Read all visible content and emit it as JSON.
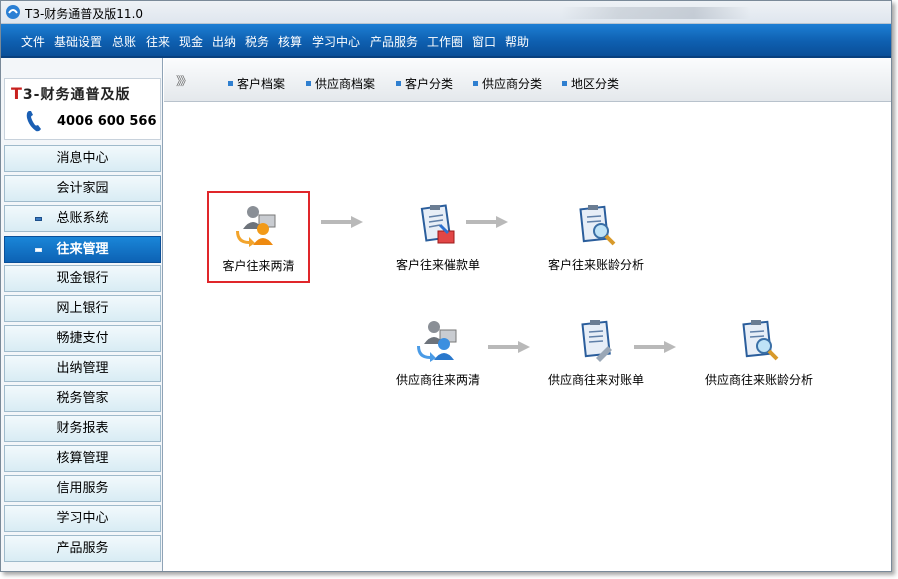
{
  "window": {
    "title": "T3-财务通普及版11.0"
  },
  "menu": [
    "文件",
    "基础设置",
    "总账",
    "往来",
    "现金",
    "出纳",
    "税务",
    "核算",
    "学习中心",
    "产品服务",
    "工作圈",
    "窗口",
    "帮助"
  ],
  "brand": {
    "logo_text_prefix": "T",
    "logo_text_rest": "3-财务通普及版",
    "phone": "4006 600 566"
  },
  "sidebar": {
    "items": [
      {
        "label": "消息中心",
        "active": false,
        "bullet": false
      },
      {
        "label": "会计家园",
        "active": false,
        "bullet": false
      },
      {
        "label": "总账系统",
        "active": false,
        "bullet": true
      },
      {
        "label": "往来管理",
        "active": true,
        "bullet": true
      },
      {
        "label": "现金银行",
        "active": false,
        "bullet": false
      },
      {
        "label": "网上银行",
        "active": false,
        "bullet": false
      },
      {
        "label": "畅捷支付",
        "active": false,
        "bullet": false
      },
      {
        "label": "出纳管理",
        "active": false,
        "bullet": false
      },
      {
        "label": "税务管家",
        "active": false,
        "bullet": false
      },
      {
        "label": "财务报表",
        "active": false,
        "bullet": false
      },
      {
        "label": "核算管理",
        "active": false,
        "bullet": false
      },
      {
        "label": "信用服务",
        "active": false,
        "bullet": false
      },
      {
        "label": "学习中心",
        "active": false,
        "bullet": false
      },
      {
        "label": "产品服务",
        "active": false,
        "bullet": false
      }
    ]
  },
  "toolbar": {
    "chevron": "》》",
    "items": [
      "客户档案",
      "供应商档案",
      "客户分类",
      "供应商分类",
      "地区分类"
    ]
  },
  "flow": {
    "customer": [
      {
        "label": "客户往来两清",
        "icon": "people-exchange-icon",
        "selected": true
      },
      {
        "label": "客户往来催款单",
        "icon": "document-notice-icon",
        "selected": false
      },
      {
        "label": "客户往来账龄分析",
        "icon": "clipboard-search-icon",
        "selected": false
      }
    ],
    "supplier": [
      {
        "label": "供应商往来两清",
        "icon": "people-exchange-icon",
        "selected": false
      },
      {
        "label": "供应商往来对账单",
        "icon": "clipboard-doc-icon",
        "selected": false
      },
      {
        "label": "供应商往来账龄分析",
        "icon": "clipboard-search-icon",
        "selected": false
      }
    ]
  },
  "colors": {
    "menubar": "#0e5fb0",
    "active_nav": "#0d62b4",
    "selection": "#e0262a",
    "toolbar_bullet": "#2f7fd0"
  }
}
